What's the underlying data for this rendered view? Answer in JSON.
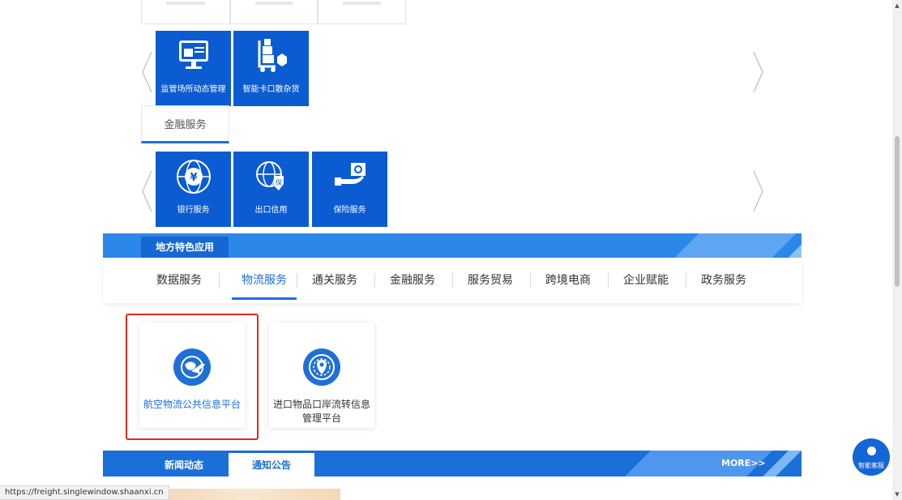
{
  "top_tiles": [
    {
      "label": "监管场所动态管理",
      "icon": "port-monitor-icon"
    },
    {
      "label": "智能卡口散杂货",
      "icon": "cargo-trolley-icon"
    }
  ],
  "finance_tab": {
    "label": "金融服务"
  },
  "finance_tiles": [
    {
      "label": "银行服务",
      "icon": "yuan-globe-icon"
    },
    {
      "label": "出口信用",
      "icon": "globe-shield-icon"
    },
    {
      "label": "保险服务",
      "icon": "safe-hand-icon"
    }
  ],
  "local_section": {
    "title": "地方特色应用"
  },
  "categories": [
    {
      "label": "数据服务",
      "active": false
    },
    {
      "label": "物流服务",
      "active": true
    },
    {
      "label": "通关服务",
      "active": false
    },
    {
      "label": "金融服务",
      "active": false
    },
    {
      "label": "服务贸易",
      "active": false
    },
    {
      "label": "跨境电商",
      "active": false
    },
    {
      "label": "企业赋能",
      "active": false
    },
    {
      "label": "政务服务",
      "active": false
    }
  ],
  "apps": [
    {
      "label": "航空物流公共信息平台",
      "icon": "plane-globe-icon",
      "highlighted": true
    },
    {
      "label": "进口物品口岸流转信息管理平台",
      "icon": "location-globe-icon",
      "highlighted": false
    }
  ],
  "news": {
    "tabs": [
      {
        "label": "新闻动态",
        "active": false
      },
      {
        "label": "通知公告",
        "active": true
      }
    ],
    "more_label": "MORE>>"
  },
  "status_url": "https://freight.singlewindow.shaanxi.cn",
  "chat_label": "智能客服",
  "colors": {
    "tile_blue": "#0b5bd3",
    "banner_blue": "#2c88e8",
    "accent": "#1a6fe0",
    "highlight_border": "#e0271f"
  }
}
